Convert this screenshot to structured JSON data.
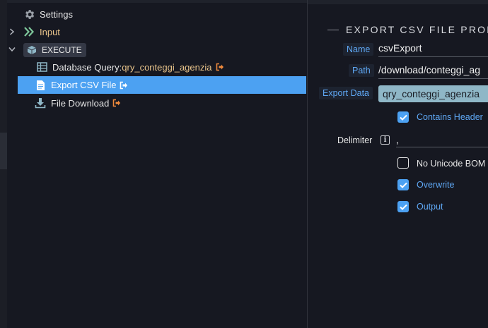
{
  "tree": {
    "settings_label": "Settings",
    "input_label": "Input",
    "execute_label": "EXECUTE",
    "items": [
      {
        "prefix": "Database Query: ",
        "name": "qry_conteggi_agenzia"
      },
      {
        "prefix": "Export CSV File",
        "name": ""
      },
      {
        "prefix": "File Download",
        "name": ""
      }
    ]
  },
  "panel": {
    "section_title": "EXPORT CSV FILE PROPERTI",
    "name_label": "Name",
    "name_value": "csvExport",
    "path_label": "Path",
    "path_value": "/download/conteggi_ag",
    "export_data_label": "Export Data",
    "export_data_value": "qry_conteggi_agenzia",
    "contains_header_label": "Contains Header",
    "contains_header_checked": true,
    "delimiter_label": "Delimiter",
    "delimiter_info_icon": "i",
    "delimiter_value": ",",
    "no_unicode_bom_label": "No Unicode BOM",
    "no_unicode_bom_checked": false,
    "overwrite_label": "Overwrite",
    "overwrite_checked": true,
    "output_label": "Output",
    "output_checked": true
  },
  "colors": {
    "accent": "#4ca1f2",
    "label_blue": "#5fa8f5",
    "exit_icon": "#f08a3c",
    "settings_icon": "#9aa0a8",
    "input_icon": "#7ec79b"
  },
  "icons": {
    "settings": "gear-icon",
    "input": "double-chevron-icon",
    "execute": "cube-icon",
    "database_query": "table-icon",
    "export_csv": "file-icon",
    "file_download": "download-icon",
    "exit": "exit-icon"
  }
}
